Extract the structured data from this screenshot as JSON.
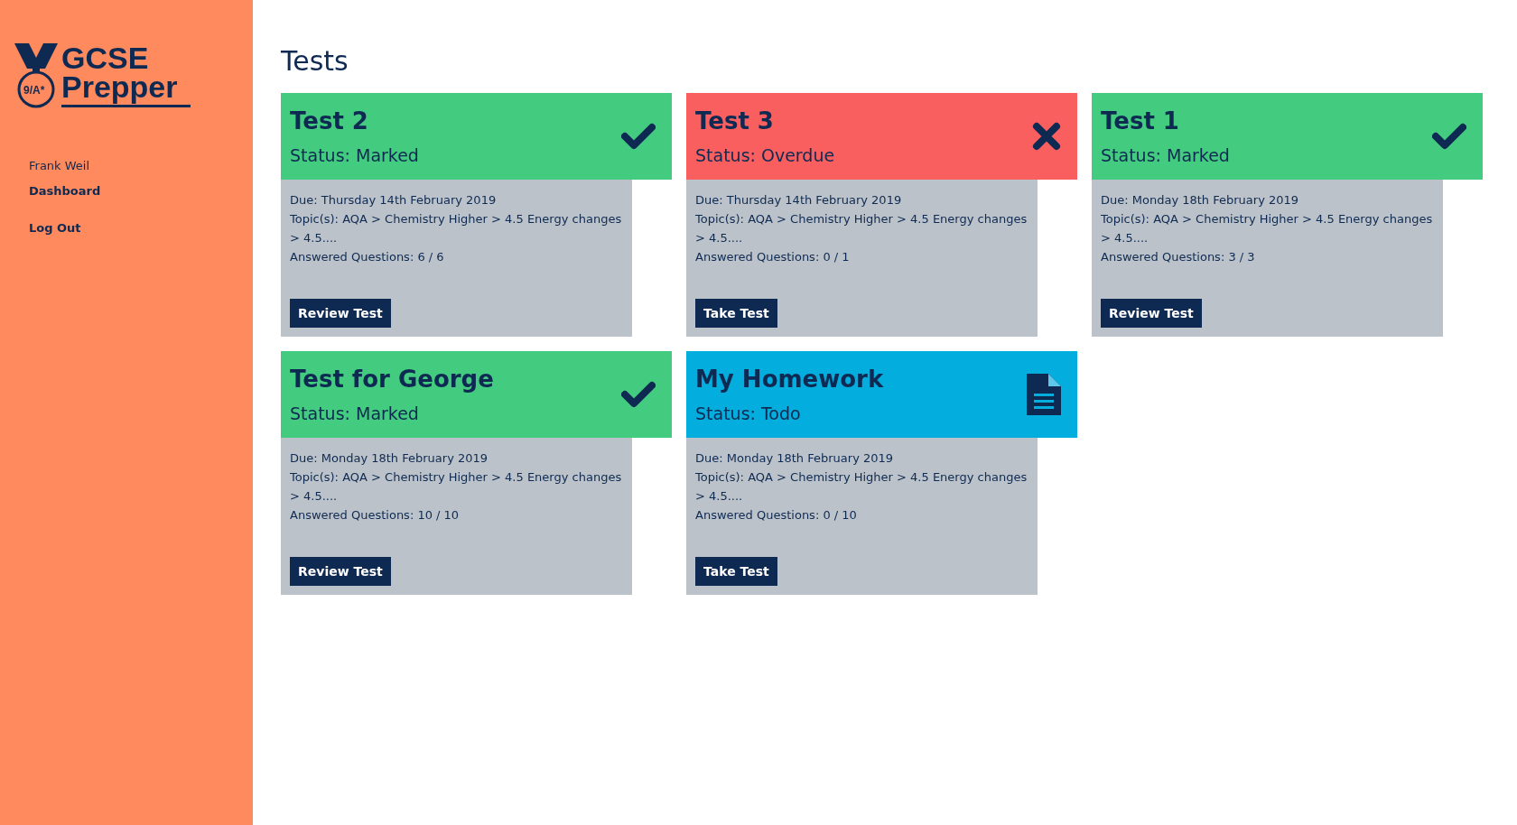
{
  "logo": {
    "badge": "9/A*",
    "line_1": "GCSE",
    "line_2": "Prepper"
  },
  "sidebar": {
    "user": "Frank Weil",
    "links": [
      "Dashboard",
      "Log Out"
    ]
  },
  "title": "Tests",
  "tests": [
    {
      "name": "Test 2",
      "status": "Status: Marked",
      "kind": "marked",
      "due": "Due: Thursday 14th February 2019",
      "topics": "Topic(s): AQA > Chemistry Higher > 4.5 Energy changes > 4.5....",
      "answered": "Answered Questions: 6 / 6",
      "action": "Review Test"
    },
    {
      "name": "Test 3",
      "status": "Status: Overdue",
      "kind": "overdue",
      "due": "Due: Thursday 14th February 2019",
      "topics": "Topic(s): AQA > Chemistry Higher > 4.5 Energy changes > 4.5....",
      "answered": "Answered Questions: 0 / 1",
      "action": "Take Test"
    },
    {
      "name": "Test 1",
      "status": "Status: Marked",
      "kind": "marked",
      "due": "Due: Monday 18th February 2019",
      "topics": "Topic(s): AQA > Chemistry Higher > 4.5 Energy changes > 4.5....",
      "answered": "Answered Questions: 3 / 3",
      "action": "Review Test"
    },
    {
      "name": "Test for George",
      "status": "Status: Marked",
      "kind": "marked",
      "due": "Due: Monday 18th February 2019",
      "topics": "Topic(s): AQA > Chemistry Higher > 4.5 Energy changes > 4.5....",
      "answered": "Answered Questions: 10 / 10",
      "action": "Review Test"
    },
    {
      "name": "My Homework",
      "status": "Status: Todo",
      "kind": "todo",
      "due": "Due: Monday 18th February 2019",
      "topics": "Topic(s): AQA > Chemistry Higher > 4.5 Energy changes > 4.5....",
      "answered": "Answered Questions: 0 / 10",
      "action": "Take Test"
    }
  ]
}
